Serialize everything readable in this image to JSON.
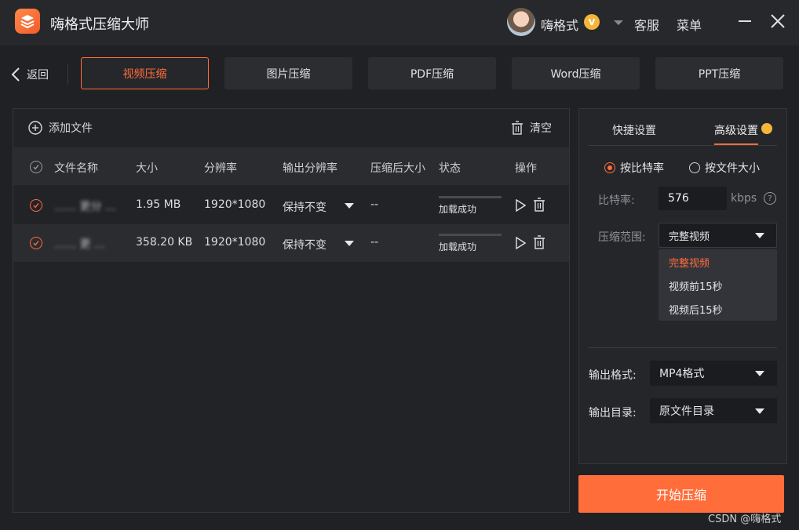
{
  "app": {
    "title": "嗨格式压缩大师",
    "username": "嗨格式",
    "vip_badge": "V",
    "links": {
      "service": "客服",
      "menu": "菜单"
    }
  },
  "nav": {
    "back_label": "返回",
    "tabs": [
      {
        "label": "视频压缩",
        "active": true
      },
      {
        "label": "图片压缩",
        "active": false
      },
      {
        "label": "PDF压缩",
        "active": false
      },
      {
        "label": "Word压缩",
        "active": false
      },
      {
        "label": "PPT压缩",
        "active": false
      }
    ]
  },
  "files": {
    "add_label": "添加文件",
    "clear_label": "清空",
    "columns": [
      "文件名称",
      "大小",
      "分辨率",
      "输出分辨率",
      "压缩后大小",
      "状态",
      "操作"
    ],
    "rows": [
      {
        "name": "…… 更分 …",
        "size": "1.95 MB",
        "resolution": "1920*1080",
        "output_res": "保持不变",
        "compressed": "--",
        "status": "加载成功"
      },
      {
        "name": "…… 更 …",
        "size": "358.20 KB",
        "resolution": "1920*1080",
        "output_res": "保持不变",
        "compressed": "--",
        "status": "加载成功"
      }
    ]
  },
  "settings": {
    "tabs": {
      "quick": "快捷设置",
      "advanced": "高级设置"
    },
    "mode_options": {
      "bitrate": "按比特率",
      "filesize": "按文件大小"
    },
    "bitrate_label": "比特率:",
    "bitrate_value": "576",
    "bitrate_unit": "kbps",
    "range_label": "压缩范围:",
    "range_value": "完整视频",
    "range_options": [
      "完整视频",
      "视频前15秒",
      "视频后15秒"
    ],
    "format_label": "输出格式:",
    "format_value": "MP4格式",
    "dir_label": "输出目录:",
    "dir_value": "原文件目录"
  },
  "start_label": "开始压缩",
  "watermark": "CSDN @嗨格式",
  "colors": {
    "accent": "#ff6d3a",
    "background": "#202124",
    "panel": "#25262a"
  }
}
